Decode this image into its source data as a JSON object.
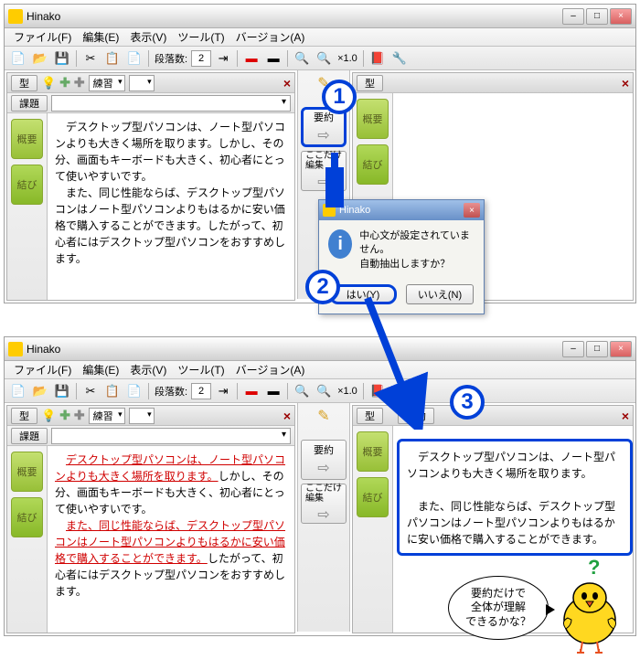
{
  "app_title": "Hinako",
  "menu": {
    "file": "ファイル(F)",
    "edit": "編集(E)",
    "view": "表示(V)",
    "tool": "ツール(T)",
    "version": "バージョン(A)"
  },
  "toolbar": {
    "danraku": "段落数:",
    "danraku_val": "2",
    "zoom": "×1.0"
  },
  "left": {
    "type_btn": "型",
    "practice": "練習",
    "kadai": "課題",
    "tab_summary": "概要",
    "tab_conclusion": "結び"
  },
  "mid": {
    "youyaku": "要約",
    "kokodake": "ここだけ\n編集"
  },
  "right": {
    "type_btn": "型",
    "tab_summary": "概要",
    "tab_conclusion": "結び",
    "youyaku": "要約"
  },
  "text1": "　デスクトップ型パソコンは、ノート型パソコンよりも大きく場所を取ります。しかし、その分、画面もキーボードも大きく、初心者にとって使いやすいです。\n　また、同じ性能ならば、デスクトップ型パソコンはノート型パソコンよりもはるかに安い価格で購入することができます。したがって、初心者にはデスクトップ型パソコンをおすすめします。",
  "hl1": "デスクトップ型パソコンは、ノート型パソコンよりも大きく場所を取ります。",
  "plain1": "しかし、その分、画面もキーボードも大きく、初心者にとって使いやすいです。",
  "hl2": "また、同じ性能ならば、デスクトップ型パソコンはノート型パソコンよりもはるかに安い価格で購入することができます。",
  "plain2": "したがって、初心者にはデスクトップ型パソコンをおすすめします。",
  "summary": "　デスクトップ型パソコンは、ノート型パソコンよりも大きく場所を取ります。\n\n　また、同じ性能ならば、デスクトップ型パソコンはノート型パソコンよりもはるかに安い価格で購入することができます。",
  "dialog": {
    "title": "Hinako",
    "msg": "中心文が設定されていません。\n自動抽出しますか？",
    "yes": "はい(Y)",
    "no": "いいえ(N)"
  },
  "speech": "要約だけで\n全体が理解\nできるかな？",
  "step1": "1",
  "step2": "2",
  "step3": "3"
}
